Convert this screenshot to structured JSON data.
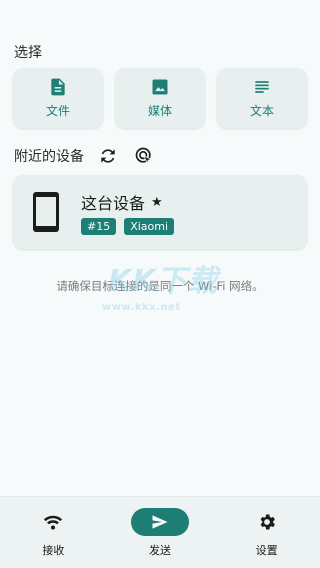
{
  "select_section": {
    "title": "选择",
    "tiles": [
      {
        "label": "文件",
        "icon": "file-icon"
      },
      {
        "label": "媒体",
        "icon": "image-icon"
      },
      {
        "label": "文本",
        "icon": "text-icon"
      }
    ]
  },
  "nearby_section": {
    "title": "附近的设备",
    "refresh_icon": "refresh-icon",
    "scan_icon": "scan-target-icon"
  },
  "device": {
    "name": "这台设备",
    "star": "★",
    "badges": [
      "#15",
      "Xiaomi"
    ]
  },
  "hint_text": "请确保目标连接的是同一个 Wi-Fi 网络。",
  "watermark": {
    "text": "KK下载",
    "url": "www.kkx.net"
  },
  "bottom_nav": {
    "receive_label": "接收",
    "send_label": "发送",
    "settings_label": "设置"
  },
  "colors": {
    "accent": "#1c7e75",
    "card_bg": "#e7f0ef",
    "page_bg": "#f7fafa"
  }
}
